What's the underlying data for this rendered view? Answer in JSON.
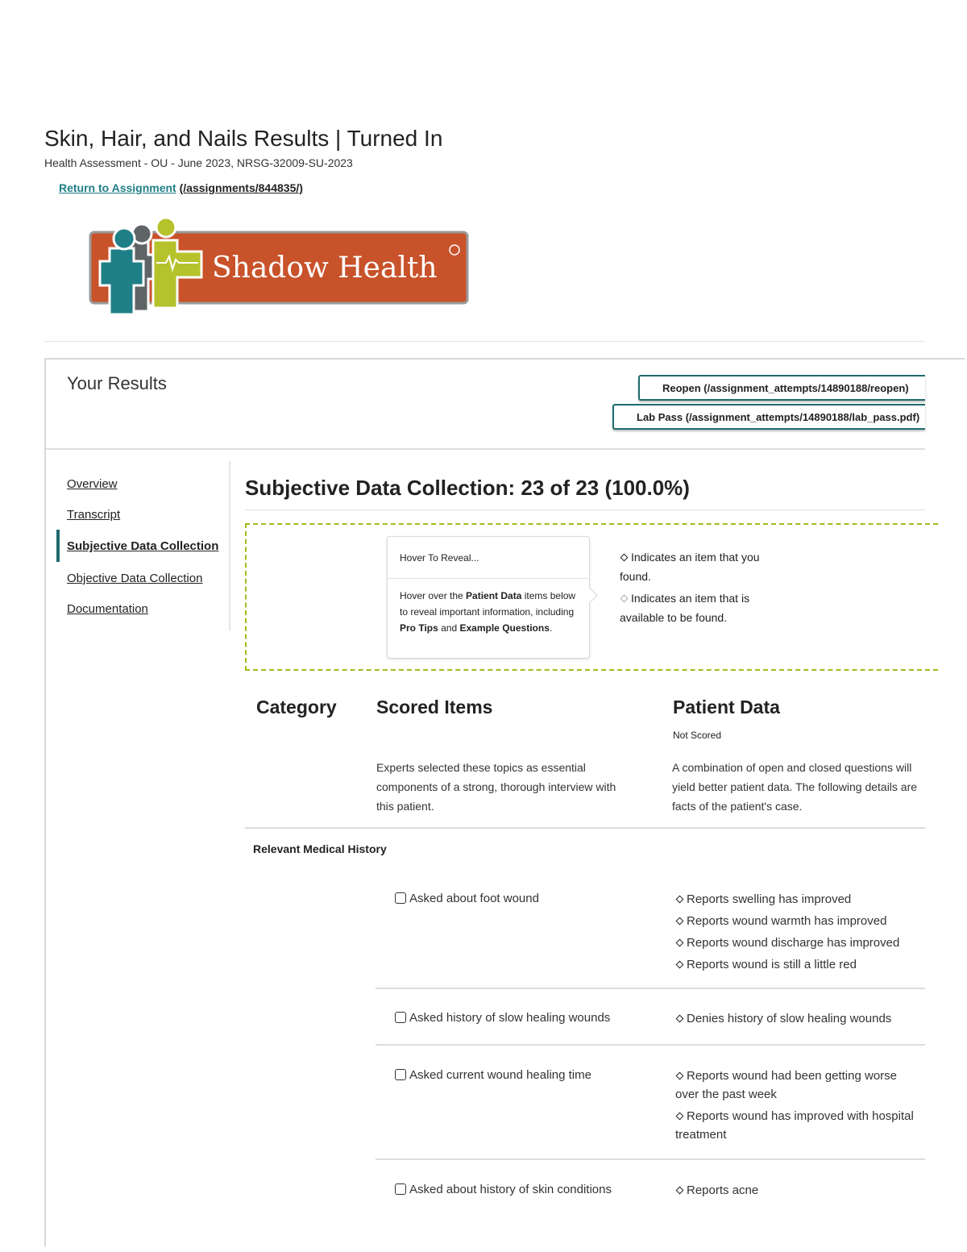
{
  "header": {
    "title": "Skin, Hair, and Nails Results | Turned In",
    "course": "Health Assessment - OU - June 2023, NRSG-32009-SU-2023",
    "return_link_text": "Return to Assignment",
    "return_link_path": "(/assignments/844835/)"
  },
  "logo": {
    "text": "Shadow Health",
    "colors": {
      "orange": "#c8522a",
      "teal": "#1f7f86",
      "lime": "#b5c22b"
    }
  },
  "results": {
    "heading": "Your Results",
    "reopen_label": "Reopen (/assignment_attempts/14890188/reopen)",
    "labpass_label": "Lab Pass (/assignment_attempts/14890188/lab_pass.pdf)"
  },
  "nav": {
    "items": [
      "Overview",
      "Transcript",
      "Subjective Data Collection",
      "Objective Data Collection",
      "Documentation"
    ],
    "active": "Subjective Data Collection"
  },
  "section": {
    "title": "Subjective Data Collection: 23 of 23 (100.0%)"
  },
  "legend": {
    "hover_title": "Hover To Reveal...",
    "hover_body_1": "Hover over the ",
    "hover_bold_1": "Patient Data",
    "hover_body_2": " items below to reveal important information, including ",
    "hover_bold_2": "Pro Tips",
    "hover_body_3": " and ",
    "hover_bold_3": "Example Questions",
    "hover_body_4": ".",
    "found_text": "Indicates an item that you found.",
    "available_text": "Indicates an item that is available to be found."
  },
  "table": {
    "col_category": "Category",
    "col_scored": "Scored Items",
    "col_patient": "Patient Data",
    "not_scored": "Not Scored",
    "scored_desc": "Experts selected these topics as essential components of a strong, thorough interview with this patient.",
    "patient_desc": "A combination of open and closed questions will yield better patient data. The following details are facts of the patient's case.",
    "category": "Relevant Medical History",
    "rows": [
      {
        "scored": "Asked about foot wound",
        "data": [
          "Reports swelling has improved",
          "Reports wound warmth has improved",
          "Reports wound discharge has improved",
          "Reports wound is still a little red"
        ]
      },
      {
        "scored": "Asked history of slow healing wounds",
        "data": [
          "Denies history of slow healing wounds"
        ]
      },
      {
        "scored": "Asked current wound healing time",
        "data": [
          "Reports wound had been getting worse over the past week",
          "Reports wound has improved with hospital treatment"
        ]
      },
      {
        "scored": "Asked about history of skin conditions",
        "data": [
          "Reports acne"
        ]
      }
    ]
  }
}
